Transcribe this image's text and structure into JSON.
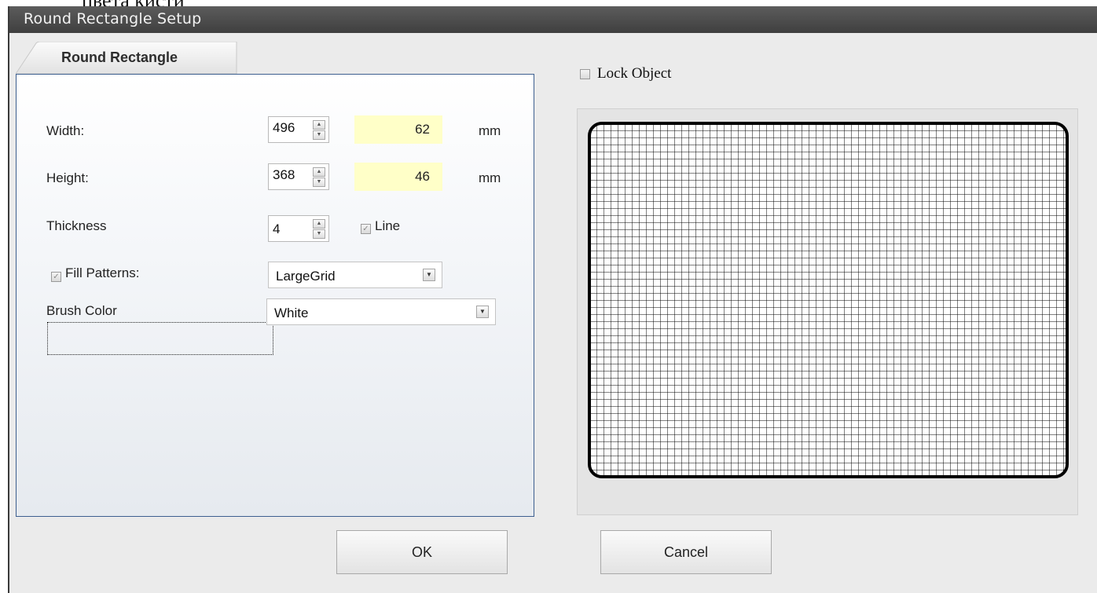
{
  "stray_text": "цвета кисти",
  "window": {
    "title": "Round Rectangle Setup"
  },
  "tab": {
    "label": "Round Rectangle"
  },
  "form": {
    "width": {
      "label": "Width:",
      "value": "496",
      "mm_value": "62",
      "unit": "mm"
    },
    "height": {
      "label": "Height:",
      "value": "368",
      "mm_value": "46",
      "unit": "mm"
    },
    "thickness": {
      "label": "Thickness",
      "value": "4",
      "line_label": "Line",
      "line_checked": true
    },
    "fill_patterns": {
      "label": "Fill Patterns:",
      "checked": true,
      "value": "LargeGrid"
    },
    "brush_color": {
      "label": "Brush Color",
      "value": "White"
    }
  },
  "lock_object": {
    "label": "Lock Object",
    "checked": false
  },
  "preview": {
    "shape": "round-rectangle",
    "fill_pattern": "LargeGrid",
    "brush_color": "#ffffff",
    "line_color": "#000000"
  },
  "buttons": {
    "ok": "OK",
    "cancel": "Cancel"
  },
  "colors": {
    "titlebar": "#474747",
    "panel_border": "#3d5f8f",
    "mm_field_bg": "#ffffc8"
  }
}
